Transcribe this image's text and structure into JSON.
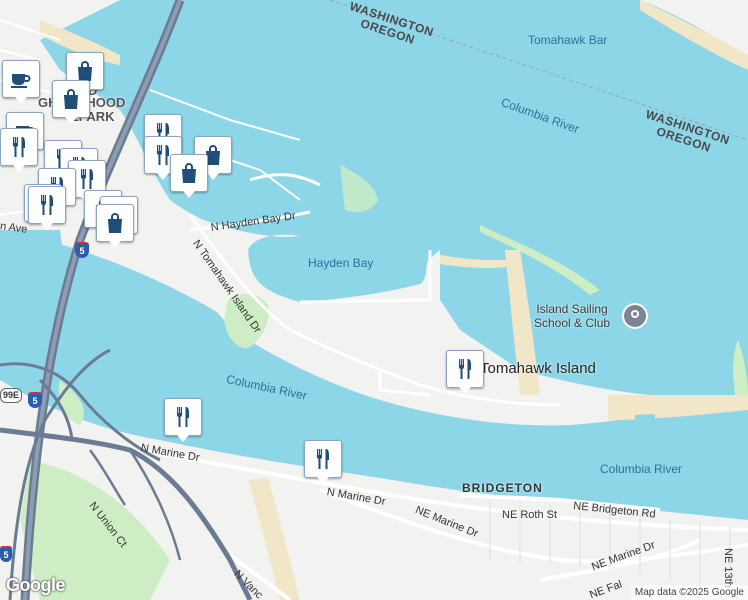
{
  "map": {
    "water_labels": {
      "columbia_river_ne": "Columbia River",
      "columbia_river_w": "Columbia River",
      "columbia_river_se": "Columbia River",
      "hayden_bay": "Hayden Bay",
      "tomahawk_bar": "Tomahawk Bar"
    },
    "place_labels": {
      "tomahawk_island": "Tomahawk Island",
      "bridgeton": "BRIDGETON"
    },
    "state_labels": {
      "boundary_top_1": "WASHINGTON",
      "boundary_top_2": "OREGON",
      "boundary_right_1": "WASHINGTON",
      "boundary_right_2": "OREGON"
    },
    "poi": {
      "sailing_school_line1": "Island Sailing",
      "sailing_school_line2": "School & Club"
    },
    "partial_labels": {
      "neighborhood_park_1": "D",
      "neighborhood_park_2": "GHBORHOOD",
      "neighborhood_park_3": "EPARK",
      "ave_fragment": "n Ave"
    },
    "roads": {
      "n_hayden_bay_dr": "N Hayden Bay Dr",
      "n_tomahawk_island_dr": "N Tomahawk Island Dr",
      "n_marine_dr_west": "N Marine Dr",
      "n_marine_dr_mid": "N Marine Dr",
      "ne_marine_dr_1": "NE Marine Dr",
      "ne_marine_dr_2": "NE Marine Dr",
      "ne_roth_st": "NE Roth St",
      "ne_bridgeton_rd": "NE Bridgeton Rd",
      "n_union_ct": "N Union Ct",
      "n_vanc": "N Vanc",
      "ne_13th": "NE 13th",
      "ne_fal": "NE Fal",
      "shield_i5_a": "5",
      "shield_i5_b": "5",
      "shield_i5_c": "5",
      "shield_99e": "99E"
    },
    "pins": [
      {
        "icon": "cafe"
      },
      {
        "icon": "shopping"
      },
      {
        "icon": "shopping"
      },
      {
        "icon": "cafe"
      },
      {
        "icon": "restaurant"
      },
      {
        "icon": "restaurant"
      },
      {
        "icon": "restaurant"
      },
      {
        "icon": "restaurant"
      },
      {
        "icon": "restaurant"
      },
      {
        "icon": "restaurant"
      },
      {
        "icon": "shopping"
      },
      {
        "icon": "restaurant"
      },
      {
        "icon": "restaurant"
      },
      {
        "icon": "shopping"
      },
      {
        "icon": "shopping"
      },
      {
        "icon": "shopping"
      },
      {
        "icon": "restaurant"
      },
      {
        "icon": "shopping"
      },
      {
        "icon": "restaurant"
      },
      {
        "icon": "restaurant"
      },
      {
        "icon": "restaurant"
      }
    ],
    "attribution": "Map data ©2025 Google",
    "logo": "Google",
    "colors": {
      "water": "#8dd6e8",
      "land": "#f2f2f0",
      "sand": "#f2e6c8",
      "park": "#cdeec4",
      "highway": "#6b7b93",
      "pin_icon": "#1f4e79"
    }
  }
}
